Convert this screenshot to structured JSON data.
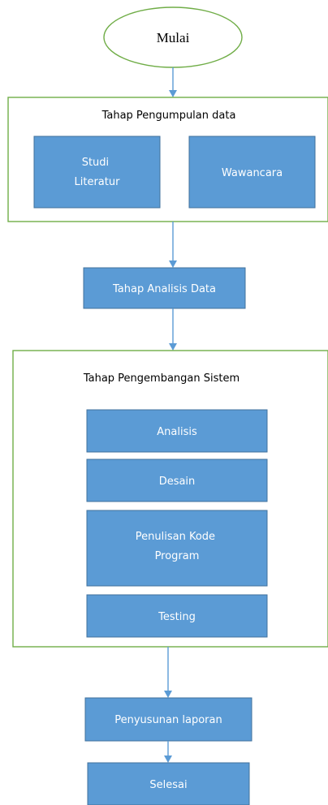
{
  "start": {
    "label": "Mulai"
  },
  "collection_stage": {
    "title": "Tahap Pengumpulan data",
    "steps": [
      {
        "lines": [
          "Studi",
          "Literatur"
        ]
      },
      {
        "lines": [
          "Wawancara"
        ]
      }
    ]
  },
  "analysis_stage": {
    "lines": [
      "Tahap Analisis Data"
    ]
  },
  "development_stage": {
    "title": "Tahap Pengembangan Sistem",
    "steps": [
      {
        "lines": [
          "Analisis"
        ]
      },
      {
        "lines": [
          "Desain"
        ]
      },
      {
        "lines": [
          "Penulisan Kode",
          "Program"
        ]
      },
      {
        "lines": [
          "Testing"
        ]
      }
    ]
  },
  "report_stage": {
    "lines": [
      "Penyusunan laporan"
    ]
  },
  "end": {
    "lines": [
      "Selesai"
    ]
  },
  "colors": {
    "step_fill": "#5b9bd5",
    "step_border": "#41719c",
    "group_border": "#70ad47",
    "connector": "#5b9bd5"
  }
}
